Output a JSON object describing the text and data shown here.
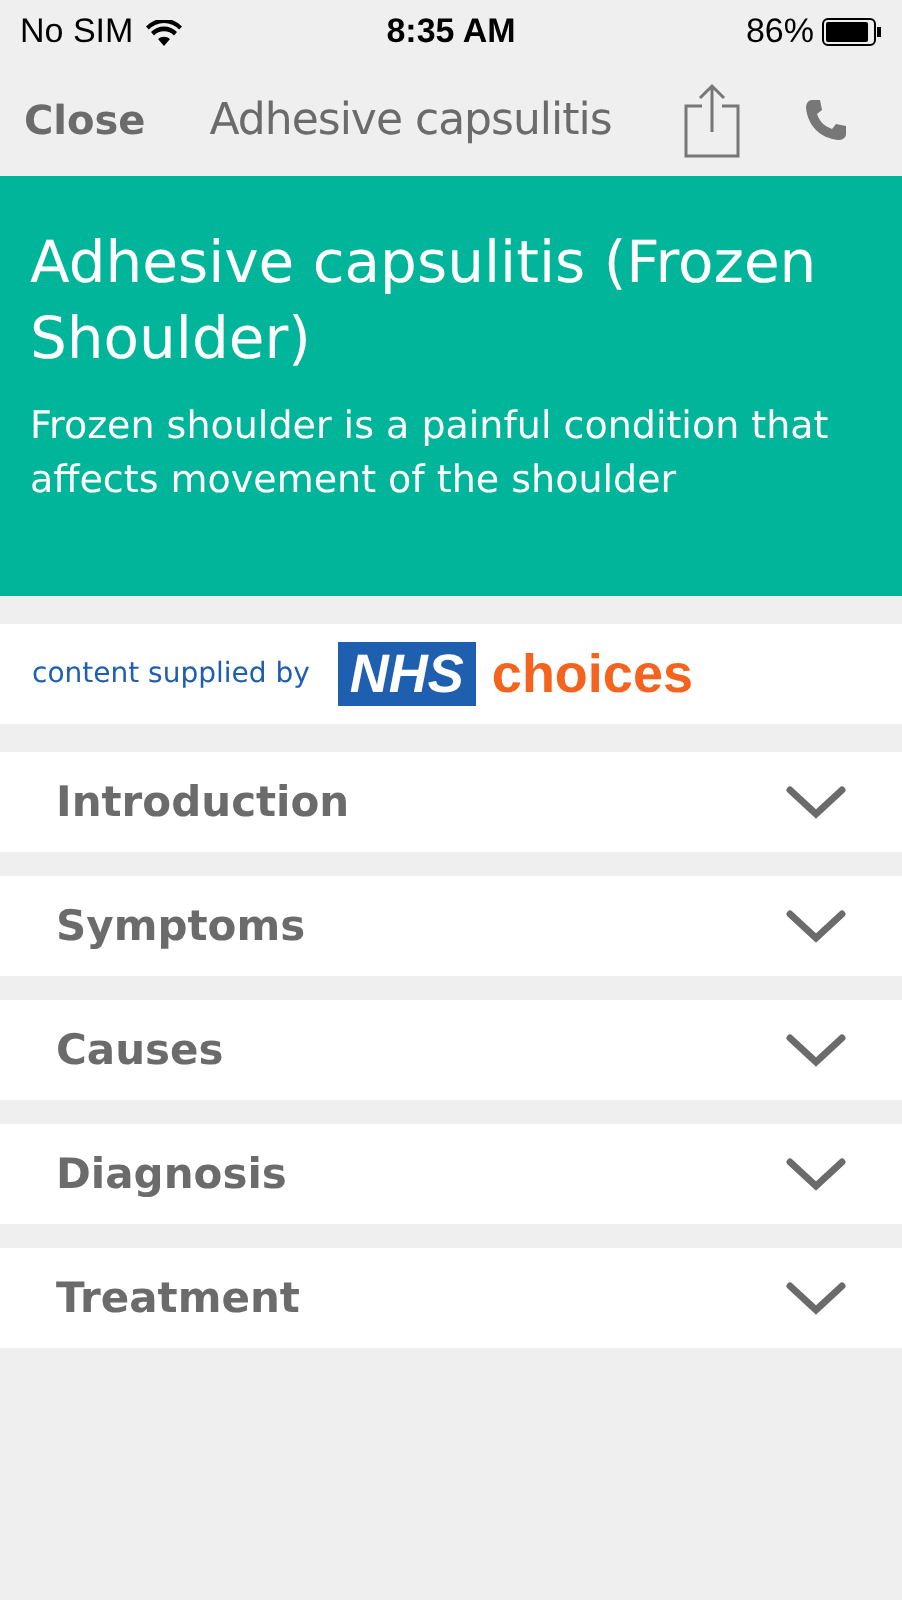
{
  "status_bar": {
    "carrier": "No SIM",
    "time": "8:35 AM",
    "battery": "86%"
  },
  "nav": {
    "close": "Close",
    "title": "Adhesive capsulitis"
  },
  "banner": {
    "title": "Adhesive capsulitis (Frozen Shoulder)",
    "subtitle": "Frozen shoulder is a painful condition that affects movement of the shoulder"
  },
  "sponsor": {
    "text": "content supplied by",
    "logo_box": "NHS",
    "logo_word": "choices"
  },
  "sections": [
    {
      "label": "Introduction",
      "expanded": false
    },
    {
      "label": "Symptoms",
      "expanded": false
    },
    {
      "label": "Causes",
      "expanded": false
    },
    {
      "label": "Diagnosis",
      "expanded": false
    },
    {
      "label": "Treatment",
      "expanded": false
    }
  ]
}
